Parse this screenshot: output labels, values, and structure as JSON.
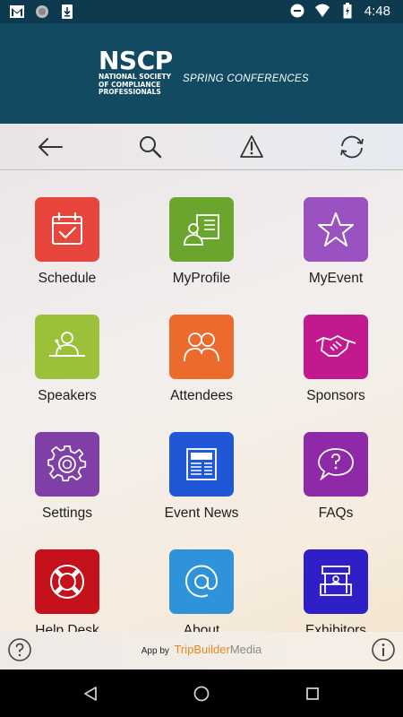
{
  "status_bar": {
    "time": "4:48",
    "icons": [
      "gmail-icon",
      "circle-notification-icon",
      "download-icon",
      "do-not-disturb-icon",
      "wifi-icon",
      "battery-charging-icon"
    ]
  },
  "header": {
    "logo_main": "NSCP",
    "logo_sub": "NATIONAL SOCIETY OF COMPLIANCE PROFESSIONALS",
    "tagline": "SPRING CONFERENCES"
  },
  "toolbar": {
    "buttons": [
      "back-arrow-icon",
      "search-icon",
      "alert-icon",
      "sync-icon"
    ]
  },
  "grid": {
    "items": [
      {
        "label": "Schedule",
        "icon": "calendar-check-icon",
        "color": "#e8453c"
      },
      {
        "label": "MyProfile",
        "icon": "profile-card-icon",
        "color": "#6aa52e"
      },
      {
        "label": "MyEvent",
        "icon": "star-icon",
        "color": "#9a52c0"
      },
      {
        "label": "Speakers",
        "icon": "speaker-podium-icon",
        "color": "#9bc13b"
      },
      {
        "label": "Attendees",
        "icon": "people-icon",
        "color": "#ec6a2c"
      },
      {
        "label": "Sponsors",
        "icon": "handshake-icon",
        "color": "#c21a8e"
      },
      {
        "label": "Settings",
        "icon": "gear-icon",
        "color": "#7f3fa6"
      },
      {
        "label": "Event News",
        "icon": "newspaper-icon",
        "color": "#1f57d6"
      },
      {
        "label": "FAQs",
        "icon": "question-bubble-icon",
        "color": "#8e2aa8"
      },
      {
        "label": "Help Desk",
        "icon": "lifebuoy-icon",
        "color": "#c4111c"
      },
      {
        "label": "About",
        "icon": "at-sign-icon",
        "color": "#2f93dc"
      },
      {
        "label": "Exhibitors",
        "icon": "booth-icon",
        "color": "#2f1fc6"
      }
    ]
  },
  "footer": {
    "credit_prefix": "App by",
    "credit_brand1": "TripBuilder",
    "credit_brand2": "Media"
  },
  "navbar": {
    "buttons": [
      "back-triangle-icon",
      "home-circle-icon",
      "recents-square-icon"
    ]
  }
}
